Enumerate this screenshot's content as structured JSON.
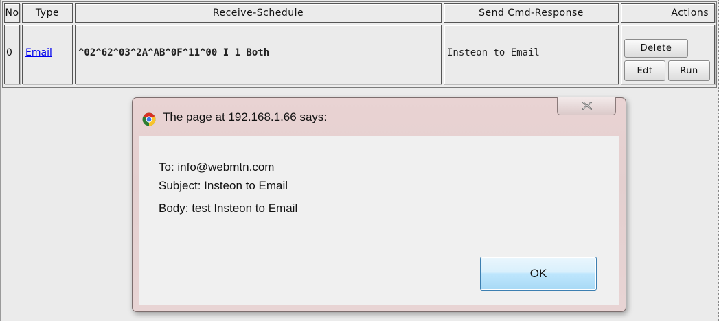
{
  "table": {
    "headers": {
      "no": "No",
      "type": "Type",
      "receive_schedule": "Receive-Schedule",
      "send_cmd_response": "Send Cmd-Response",
      "actions": "Actions"
    },
    "rows": [
      {
        "no": "0",
        "type": "Email",
        "receive_schedule": "^02^62^03^2A^AB^0F^11^00 I 1 Both",
        "send_cmd_response": "Insteon to Email",
        "actions": {
          "delete": "Delete",
          "edit": "Edt",
          "run": "Run"
        }
      }
    ]
  },
  "dialog": {
    "title": "The page at 192.168.1.66 says:",
    "lines": {
      "to": "To: info@webmtn.com",
      "subject": "Subject: Insteon to Email",
      "body": "Body: test Insteon to Email"
    },
    "ok_label": "OK",
    "icons": {
      "app": "chrome-icon",
      "close": "close-icon"
    }
  },
  "colors": {
    "link": "#0000ee",
    "dialog_frame": "#e6d1d1",
    "ok_button": "#bee6fd"
  }
}
